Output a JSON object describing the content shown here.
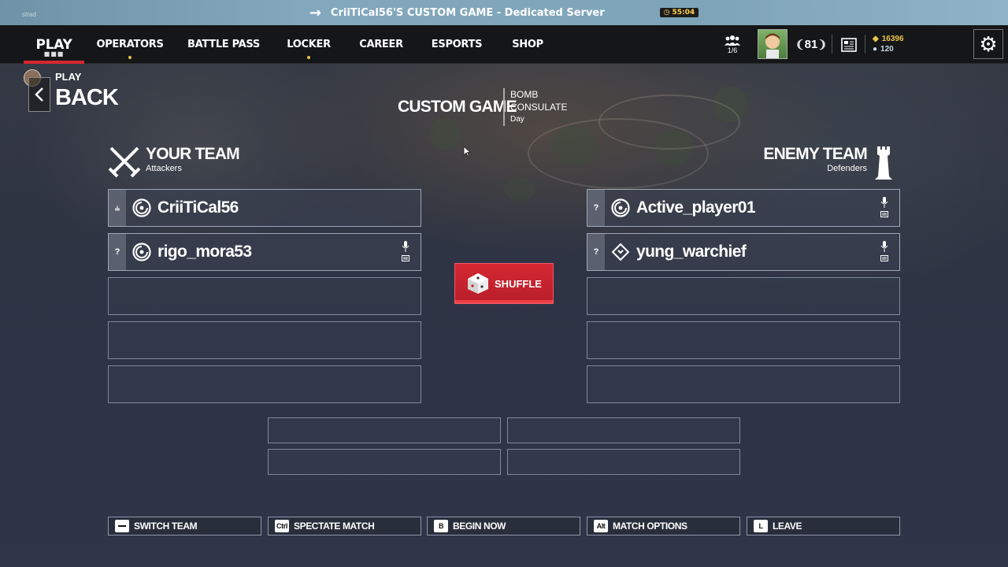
{
  "server_bar": {
    "title": "CriiTiCal56'S CUSTOM GAME - Dedicated Server",
    "timer": "55:04",
    "ghost_label": "strad"
  },
  "nav": {
    "play": "PLAY",
    "items": [
      "OPERATORS",
      "BATTLE PASS",
      "LOCKER",
      "CAREER",
      "ESPORTS",
      "SHOP"
    ],
    "squad_count": "1/6",
    "level": "81",
    "currency_gold": "16396",
    "currency_blue": "120"
  },
  "back": {
    "small": "PLAY",
    "label": "BACK"
  },
  "game": {
    "title": "CUSTOM GAME",
    "mode": "BOMB",
    "map": "CONSULATE",
    "time": "Day"
  },
  "your_team": {
    "name": "YOUR TEAM",
    "role": "Attackers",
    "players": [
      {
        "badge": "⫨",
        "name": "CriiTiCal56"
      },
      {
        "badge": "?",
        "name": "rigo_mora53"
      }
    ]
  },
  "enemy_team": {
    "name": "ENEMY TEAM",
    "role": "Defenders",
    "players": [
      {
        "badge": "?",
        "name": "Active_player01"
      },
      {
        "badge": "?",
        "name": "yung_warchief"
      }
    ]
  },
  "shuffle_label": "SHUFFLE",
  "actions": [
    {
      "key": "",
      "label": "SWITCH TEAM"
    },
    {
      "key": "Ctrl",
      "label": "SPECTATE MATCH"
    },
    {
      "key": "B",
      "label": "BEGIN NOW"
    },
    {
      "key": "Alt",
      "label": "MATCH OPTIONS"
    },
    {
      "key": "L",
      "label": "LEAVE"
    }
  ],
  "colors": {
    "accent_red": "#d52833",
    "gold": "#e9c547",
    "server_bar": "#7ea4b9"
  }
}
